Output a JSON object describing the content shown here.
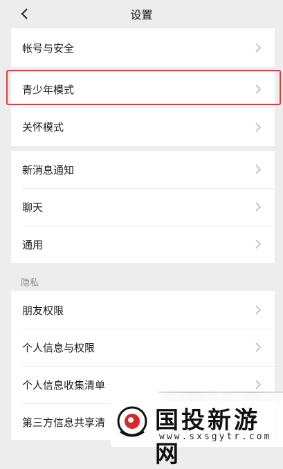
{
  "header": {
    "title": "设置"
  },
  "groups": [
    {
      "items": [
        "帐号与安全"
      ]
    },
    {
      "items": [
        "青少年模式",
        "关怀模式"
      ]
    },
    {
      "items": [
        "新消息通知",
        "聊天",
        "通用"
      ]
    },
    {
      "section_label": "隐私",
      "items": [
        "朋友权限",
        "个人信息与权限",
        "个人信息收集清单",
        "第三方信息共享清"
      ]
    }
  ],
  "highlight_color": "#e23b3b",
  "watermark": {
    "text": "国投新游网",
    "url": "www.sxsgytr.com"
  }
}
